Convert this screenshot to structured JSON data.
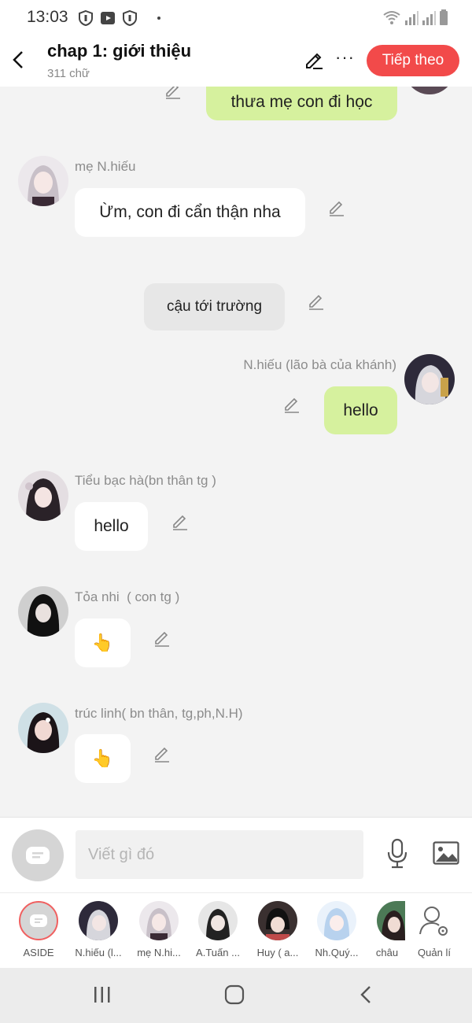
{
  "status_bar": {
    "time": "13:03"
  },
  "header": {
    "title": "chap 1: giới thiệu",
    "word_count": "311 chữ",
    "next_label": "Tiếp theo"
  },
  "messages": [
    {
      "type": "outgoing",
      "text": "thưa mẹ con đi học"
    },
    {
      "type": "incoming",
      "name": "mẹ N.hiếu",
      "text": "Ừm, con đi cẩn thận nha"
    },
    {
      "type": "narration",
      "text": "cậu tới trường"
    },
    {
      "type": "outgoing",
      "name": "N.hiếu (lão bà của khánh)",
      "text": "hello"
    },
    {
      "type": "incoming",
      "name": "Tiểu bạc hà(bn thân tg )",
      "text": "hello"
    },
    {
      "type": "incoming",
      "name": "Tỏa nhi  ( con tg )",
      "text": "👆"
    },
    {
      "type": "incoming",
      "name": "trúc linh( bn thân, tg,ph,N.H)",
      "text": "👆"
    }
  ],
  "input": {
    "placeholder": "Viết gì đó"
  },
  "characters": [
    {
      "label": "ASIDE"
    },
    {
      "label": "N.hiếu (l..."
    },
    {
      "label": "mẹ N.hi..."
    },
    {
      "label": "A.Tuấn ..."
    },
    {
      "label": "Huy ( a..."
    },
    {
      "label": "Nh.Quý..."
    },
    {
      "label": "châu"
    },
    {
      "label": "Quản lí"
    }
  ],
  "colors": {
    "accent": "#f24a4a",
    "outgoing_bubble": "#d6f19e",
    "background": "#f3f3f3"
  }
}
